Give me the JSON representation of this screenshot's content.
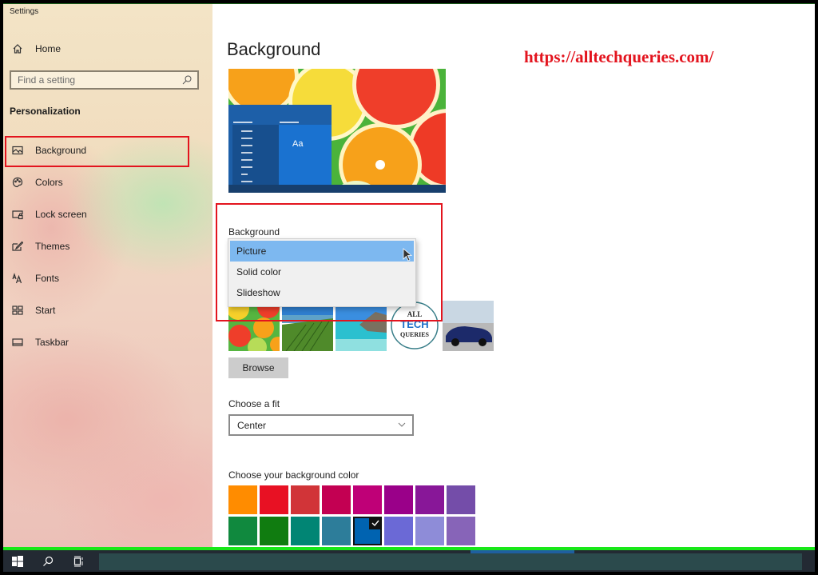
{
  "window": {
    "title": "Settings"
  },
  "sidebar": {
    "home_label": "Home",
    "search_placeholder": "Find a setting",
    "section_title": "Personalization",
    "items": [
      {
        "label": "Background",
        "icon": "picture-icon",
        "selected": true
      },
      {
        "label": "Colors",
        "icon": "palette-icon"
      },
      {
        "label": "Lock screen",
        "icon": "lock-screen-icon"
      },
      {
        "label": "Themes",
        "icon": "themes-brush-icon"
      },
      {
        "label": "Fonts",
        "icon": "fonts-icon"
      },
      {
        "label": "Start",
        "icon": "start-tiles-icon"
      },
      {
        "label": "Taskbar",
        "icon": "taskbar-icon"
      }
    ]
  },
  "main": {
    "page_title": "Background",
    "watermark": "https://alltechqueries.com/",
    "preview_sample_text": "Aa",
    "background_label": "Background",
    "background_options": [
      {
        "label": "Picture",
        "selected": true
      },
      {
        "label": "Solid color",
        "selected": false
      },
      {
        "label": "Slideshow",
        "selected": false
      }
    ],
    "thumbnails": [
      "citrus-slices",
      "vineyard-lake",
      "tropical-beach",
      "alltechqueries-logo",
      "blue-sports-car"
    ],
    "logo_thumb_text": [
      "ALL",
      "TECH",
      "QUERIES"
    ],
    "browse_label": "Browse",
    "fit_label": "Choose a fit",
    "fit_value": "Center",
    "color_label": "Choose your background color",
    "colors": [
      "#ff8c00",
      "#e81123",
      "#d13438",
      "#c30052",
      "#bf0077",
      "#9a0089",
      "#881798",
      "#744da9",
      "#10893e",
      "#107c10",
      "#018574",
      "#2d7d9a",
      "#0063b1",
      "#6b69d6",
      "#8e8cd8",
      "#8764b8"
    ],
    "selected_color_index": 12
  },
  "taskbar": {
    "start_label": "Start",
    "search_label": "Search",
    "task_view_label": "Task View"
  },
  "accent": {
    "highlight_box": "#e3141e",
    "selection": "#7db8f0"
  }
}
